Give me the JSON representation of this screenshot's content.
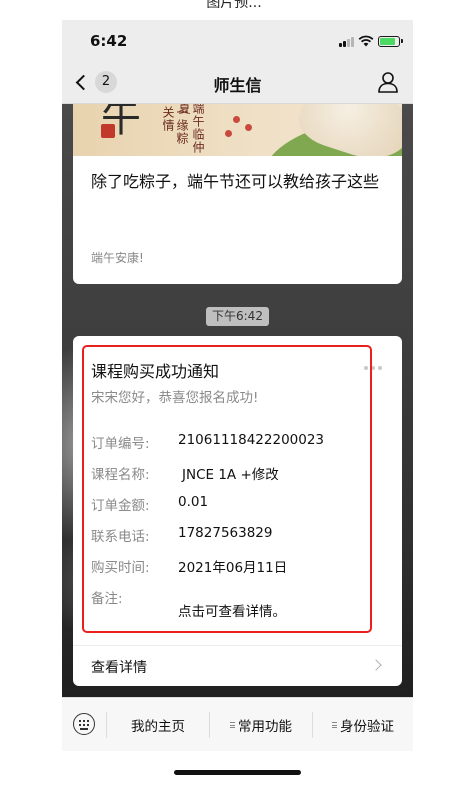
{
  "top_caption": "图片预...",
  "status": {
    "time": "6:42"
  },
  "nav": {
    "back_count": "2",
    "title": "师生信"
  },
  "article": {
    "banner_big": "午",
    "banner_v1": "一缘粽关情",
    "banner_v2": "端午临仲夏",
    "title": "除了吃粽子，端午节还可以教给孩子这些",
    "subtitle": "端午安康!"
  },
  "time_chip": "下午6:42",
  "notice": {
    "title": "课程购买成功通知",
    "greeting": "宋宋您好，恭喜您报名成功!",
    "fields": [
      {
        "label": "订单编号:",
        "value": "21061118422200023"
      },
      {
        "label": "课程名称:",
        "value": "JNCE 1A +修改"
      },
      {
        "label": "订单金额:",
        "value": "0.01"
      },
      {
        "label": "联系电话:",
        "value": "17827563829"
      },
      {
        "label": "购买时间:",
        "value": "2021年06月11日"
      },
      {
        "label": "备注:",
        "value": ""
      }
    ],
    "note": "点击可查看详情。",
    "detail_label": "查看详情"
  },
  "menu": {
    "items": [
      {
        "label": "我的主页"
      },
      {
        "label": "常用功能"
      },
      {
        "label": "身份验证"
      }
    ]
  },
  "colors": {
    "highlight_border": "#e8211e",
    "battery": "#4cd964",
    "chat_bg": "#3e3e3e"
  }
}
